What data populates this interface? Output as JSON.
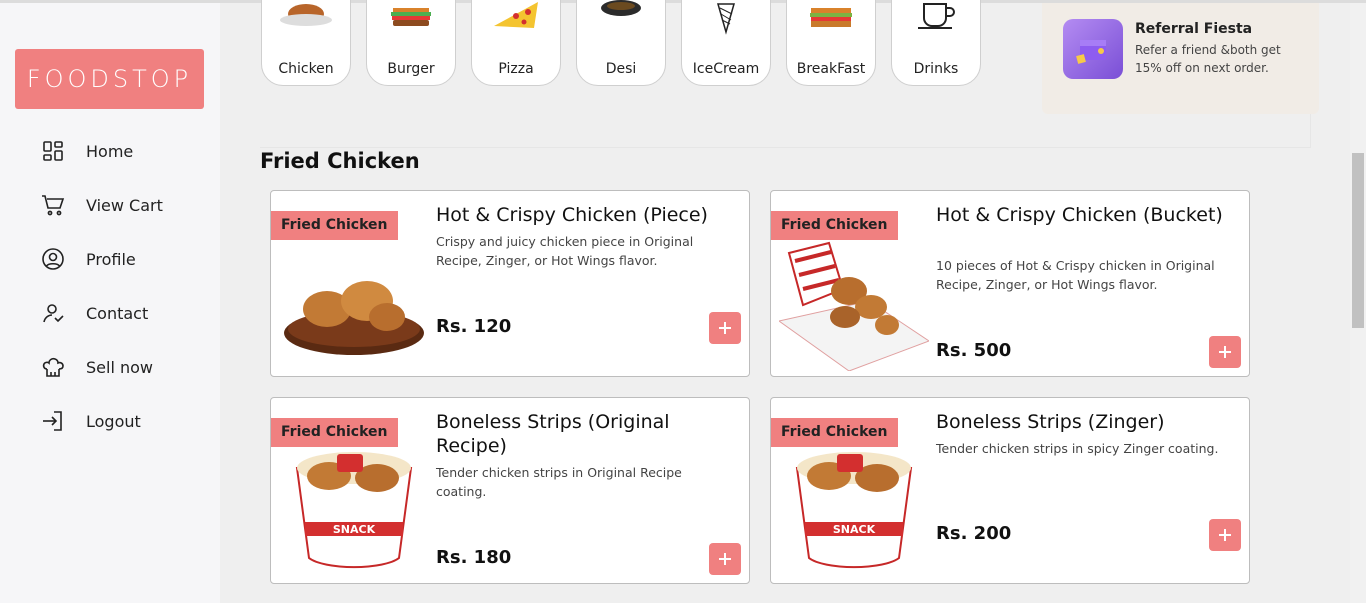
{
  "brand": {
    "logo_text": "FOODSTOP",
    "accent": "#f08080"
  },
  "sidebar": {
    "items": [
      {
        "label": "Home",
        "icon": "grid-icon"
      },
      {
        "label": "View Cart",
        "icon": "cart-icon"
      },
      {
        "label": "Profile",
        "icon": "user-circle-icon"
      },
      {
        "label": "Contact",
        "icon": "contact-icon"
      },
      {
        "label": "Sell now",
        "icon": "chef-hat-icon"
      },
      {
        "label": "Logout",
        "icon": "logout-icon"
      }
    ]
  },
  "categories": [
    {
      "label": "Chicken",
      "icon": "chicken-icon"
    },
    {
      "label": "Burger",
      "icon": "burger-icon"
    },
    {
      "label": "Pizza",
      "icon": "pizza-icon"
    },
    {
      "label": "Desi",
      "icon": "desi-bowl-icon"
    },
    {
      "label": "IceCream",
      "icon": "icecream-icon"
    },
    {
      "label": "BreakFast",
      "icon": "sandwich-icon"
    },
    {
      "label": "Drinks",
      "icon": "cup-icon"
    }
  ],
  "referral": {
    "title": "Referral Fiesta",
    "description": "Refer a friend &both get 15% off on next order."
  },
  "section": {
    "title": "Fried Chicken"
  },
  "products": [
    {
      "tag": "Fried Chicken",
      "title": "Hot & Crispy Chicken (Piece)",
      "description": "Crispy and juicy chicken piece in Original Recipe, Zinger, or Hot Wings flavor.",
      "price": "Rs. 120",
      "image": "chicken-plate-image"
    },
    {
      "tag": "Fried Chicken",
      "title": "Hot & Crispy Chicken (Bucket)",
      "description": "10 pieces of Hot & Crispy chicken in Original Recipe, Zinger, or Hot Wings flavor.",
      "price": "Rs. 500",
      "image": "chicken-bucket-image"
    },
    {
      "tag": "Fried Chicken",
      "title": "Boneless Strips (Original Recipe)",
      "description": "Tender chicken strips in Original Recipe coating.",
      "price": "Rs. 180",
      "image": "snack-bucket-image"
    },
    {
      "tag": "Fried Chicken",
      "title": "Boneless Strips (Zinger)",
      "description": "Tender chicken strips in spicy Zinger coating.",
      "price": "Rs. 200",
      "image": "snack-bucket-image"
    }
  ]
}
